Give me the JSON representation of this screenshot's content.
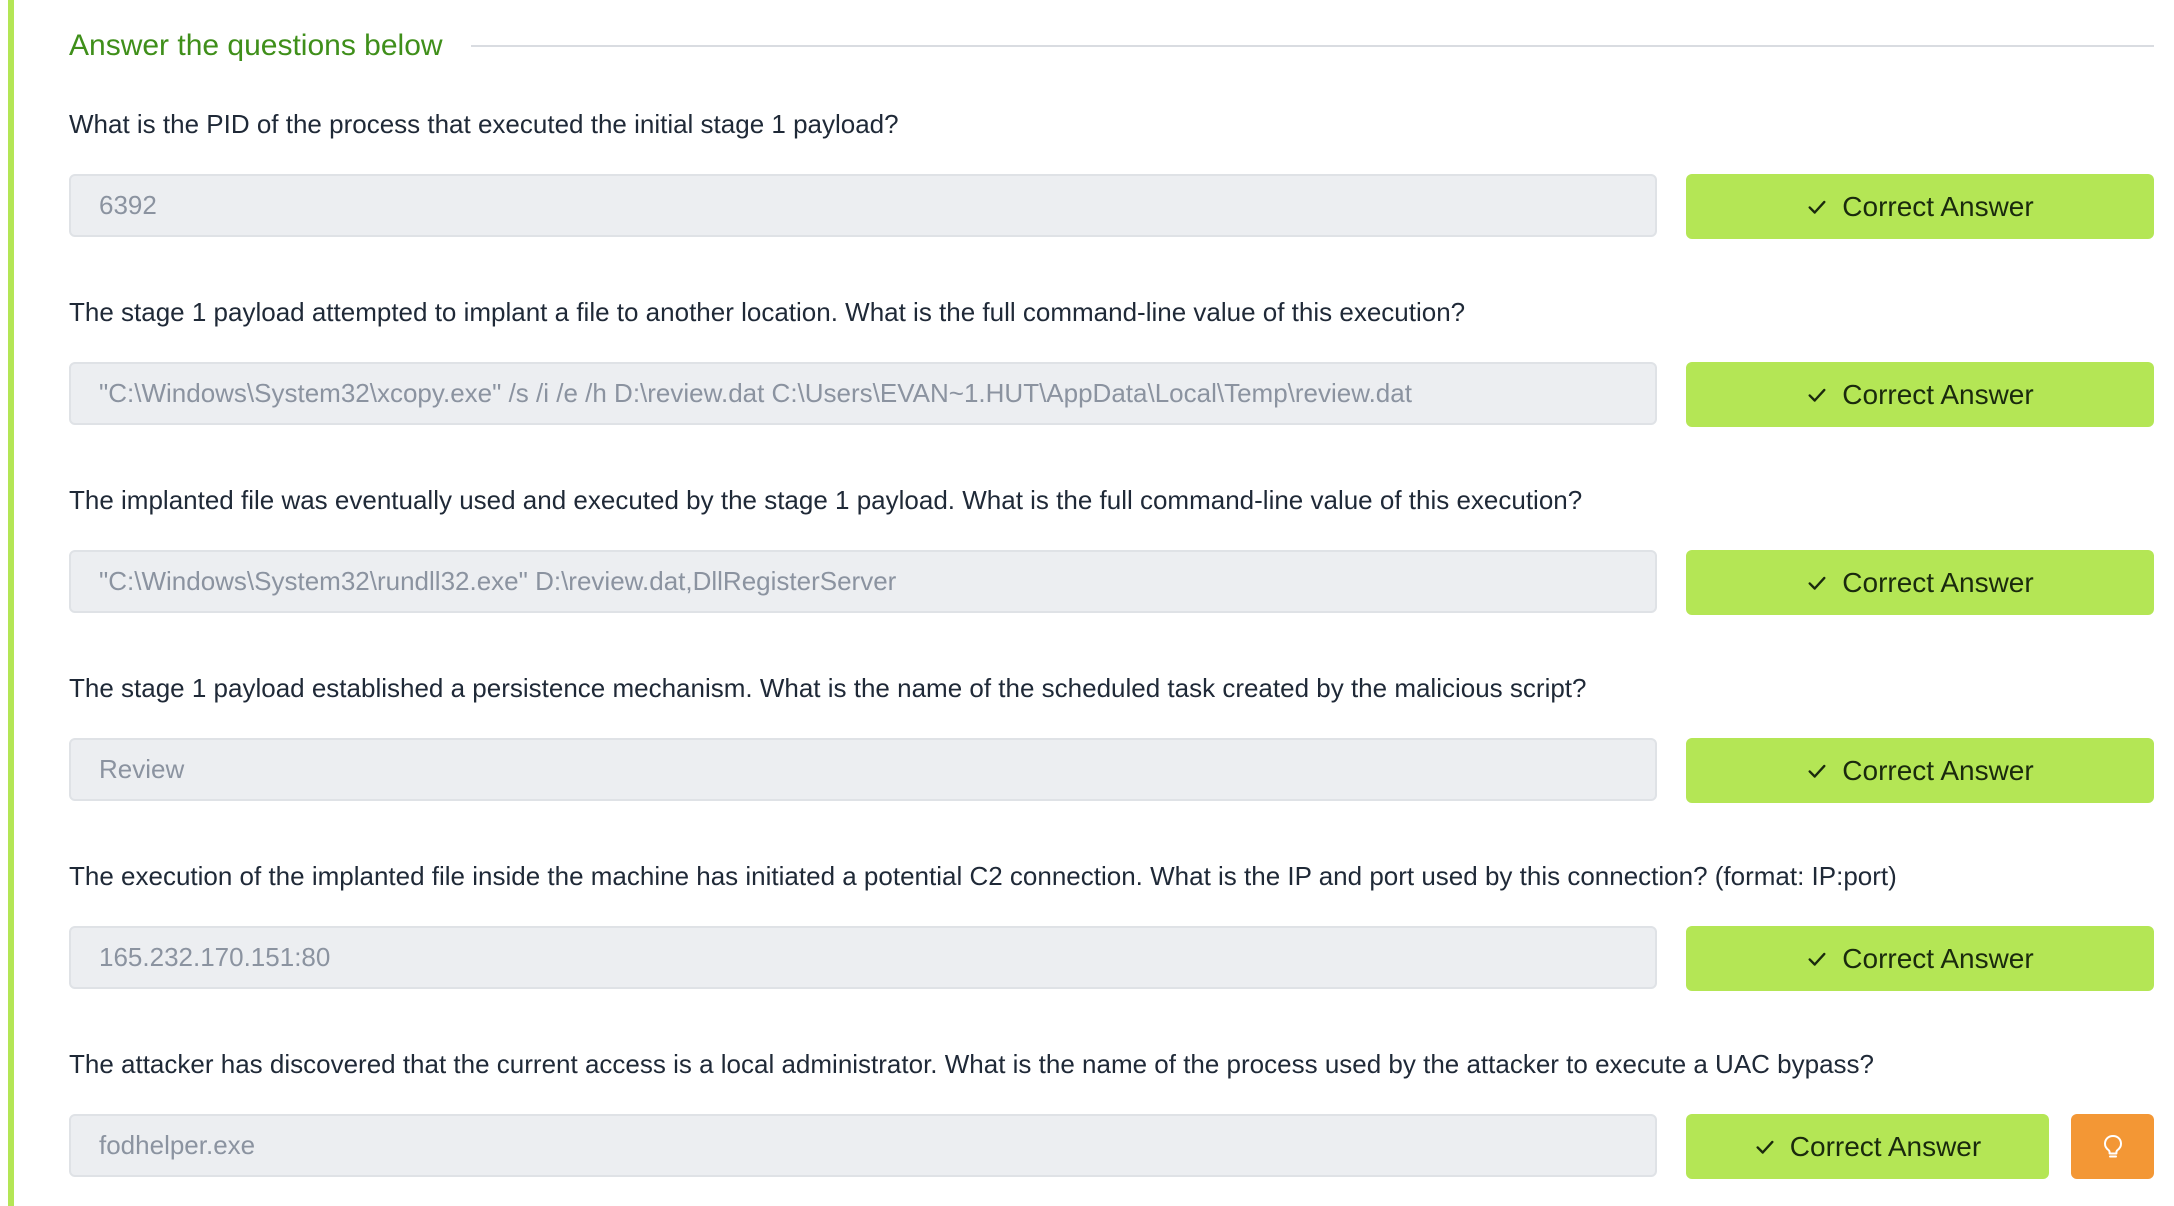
{
  "header": {
    "title": "Answer the questions below"
  },
  "questions": [
    {
      "text": "What is the PID of the process that executed the initial stage 1 payload?",
      "answer": "6392",
      "button_label": "Correct Answer"
    },
    {
      "text": "The stage 1 payload attempted to implant a file to another location. What is the full command-line value of this execution?",
      "answer": "\"C:\\Windows\\System32\\xcopy.exe\" /s /i /e /h D:\\review.dat C:\\Users\\EVAN~1.HUT\\AppData\\Local\\Temp\\review.dat",
      "button_label": "Correct Answer"
    },
    {
      "text": "The implanted file was eventually used and executed by the stage 1 payload. What is the full command-line value of this execution?",
      "answer": "\"C:\\Windows\\System32\\rundll32.exe\" D:\\review.dat,DllRegisterServer",
      "button_label": "Correct Answer"
    },
    {
      "text": "The stage 1 payload established a persistence mechanism. What is the name of the scheduled task created by the malicious script?",
      "answer": "Review",
      "button_label": "Correct Answer"
    },
    {
      "text": "The execution of the implanted file inside the machine has initiated a potential C2 connection. What is the IP and port used by this connection? (format: IP:port)",
      "answer": "165.232.170.151:80",
      "button_label": "Correct Answer"
    },
    {
      "text": "The attacker has discovered that the current access is a local administrator. What is the name of the process used by the attacker to execute a UAC bypass?",
      "answer": "fodhelper.exe",
      "button_label": "Correct Answer"
    }
  ],
  "colors": {
    "accent_green": "#b4e655",
    "title_green": "#3f8f1a",
    "hint_orange": "#f39735"
  },
  "icons": {
    "check": "check-icon",
    "hint": "lightbulb-icon"
  }
}
